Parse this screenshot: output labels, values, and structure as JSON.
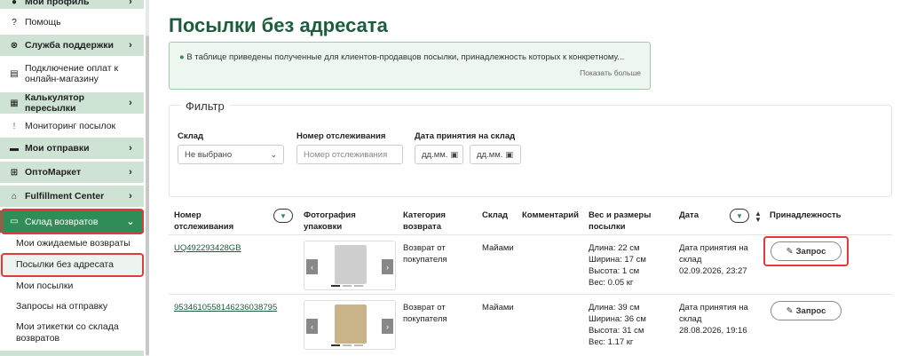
{
  "sidebar": {
    "items": [
      {
        "label": "Мой профиль",
        "icon": "user-icon",
        "chevron": "›"
      },
      {
        "label": "Помощь",
        "icon": "question-icon"
      },
      {
        "label": "Служба поддержки",
        "icon": "support-icon",
        "chevron": "›"
      },
      {
        "label": "Подключение оплат к онлайн-магазину",
        "icon": "payment-icon"
      },
      {
        "label": "Калькулятор пересылки",
        "icon": "calculator-icon",
        "chevron": "›"
      },
      {
        "label": "Мониторинг посылок",
        "icon": "alert-icon"
      },
      {
        "label": "Мои отправки",
        "icon": "truck-icon",
        "chevron": "›"
      },
      {
        "label": "ОптоМаркет",
        "icon": "cart-icon",
        "chevron": "›"
      },
      {
        "label": "Fulfillment Center",
        "icon": "warehouse-icon",
        "chevron": "›"
      },
      {
        "label": "Склад возвратов",
        "icon": "returns-icon",
        "chevron": "⌄"
      }
    ],
    "sub_items": [
      {
        "label": "Мои ожидаемые возвраты"
      },
      {
        "label": "Посылки без адресата"
      },
      {
        "label": "Мои посылки"
      },
      {
        "label": "Запросы на отправку"
      },
      {
        "label": "Мои этикетки со склада возвратов"
      }
    ]
  },
  "page": {
    "title": "Посылки без адресата",
    "info_text": "В таблице приведены полученные для клиентов-продавцов посылки, принадлежность которых к конкретному...",
    "show_more": "Показать больше"
  },
  "filter": {
    "legend": "Фильтр",
    "warehouse_label": "Склад",
    "warehouse_value": "Не выбрано",
    "tracking_label": "Номер отслеживания",
    "tracking_placeholder": "Номер отслеживания",
    "date_label": "Дата принятия на склад",
    "date_from": "дд.мм.",
    "date_to": "дд.мм."
  },
  "table": {
    "headers": {
      "tracking": "Номер отслеживания",
      "photo": "Фотография упаковки",
      "category": "Категория возврата",
      "warehouse": "Склад",
      "comment": "Комментарий",
      "weight": "Вес и размеры посылки",
      "date": "Дата",
      "ownership": "Принадлежность"
    },
    "rows": [
      {
        "tracking": "UQ492293428GB",
        "category": "Возврат от покупателя",
        "warehouse": "Майами",
        "dims": [
          "Длина: 22 см",
          "Ширина: 17 см",
          "Высота: 1 см",
          "Вес: 0.05 кг"
        ],
        "date_label": "Дата принятия на склад",
        "date_value": "02.09.2026, 23:27",
        "button": "Запрос"
      },
      {
        "tracking": "9534610558146236038795",
        "category": "Возврат от покупателя",
        "warehouse": "Майами",
        "dims": [
          "Длина: 39 см",
          "Ширина: 36 см",
          "Высота: 31 см",
          "Вес: 1.17 кг"
        ],
        "date_label": "Дата принятия на склад",
        "date_value": "28.08.2026, 19:16",
        "button": "Запрос"
      }
    ]
  },
  "colors": {
    "accent": "#2f8e58",
    "title": "#1d5c3c",
    "sidebar_green": "#cfe3d5",
    "highlight": "#e03a3a"
  }
}
